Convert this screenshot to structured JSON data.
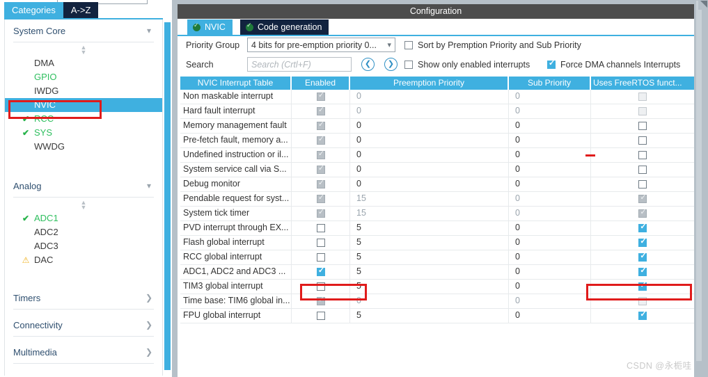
{
  "left_panel": {
    "tabs": [
      {
        "label": "Categories",
        "selected": true
      },
      {
        "label": "A->Z",
        "selected": false
      }
    ],
    "groups": [
      {
        "title": "System Core",
        "expanded": true,
        "chevron": "chevron-down-icon",
        "items": [
          {
            "label": "DMA",
            "status": "none",
            "selected": false
          },
          {
            "label": "GPIO",
            "status": "none",
            "selected": false,
            "green_text": true
          },
          {
            "label": "IWDG",
            "status": "none",
            "selected": false
          },
          {
            "label": "NVIC",
            "status": "none",
            "selected": true
          },
          {
            "label": "RCC",
            "status": "check",
            "selected": false,
            "green_text": true
          },
          {
            "label": "SYS",
            "status": "check",
            "selected": false,
            "green_text": true
          },
          {
            "label": "WWDG",
            "status": "none",
            "selected": false
          }
        ]
      },
      {
        "title": "Analog",
        "expanded": true,
        "chevron": "chevron-down-icon",
        "items": [
          {
            "label": "ADC1",
            "status": "check",
            "selected": false,
            "green_text": true
          },
          {
            "label": "ADC2",
            "status": "none",
            "selected": false
          },
          {
            "label": "ADC3",
            "status": "none",
            "selected": false
          },
          {
            "label": "DAC",
            "status": "warning",
            "selected": false
          }
        ]
      },
      {
        "title": "Timers",
        "expanded": false,
        "chevron": "chevron-right-icon",
        "items": []
      },
      {
        "title": "Connectivity",
        "expanded": false,
        "chevron": "chevron-right-icon",
        "items": []
      },
      {
        "title": "Multimedia",
        "expanded": false,
        "chevron": "chevron-right-icon",
        "items": []
      }
    ]
  },
  "config": {
    "title": "Configuration",
    "tabs": [
      {
        "label": "NVIC",
        "selected": true,
        "icon": "green-check-icon"
      },
      {
        "label": "Code generation",
        "selected": false,
        "icon": "green-check-icon"
      }
    ],
    "priority_group": {
      "label": "Priority Group",
      "value": "4 bits for pre-emption priority 0...",
      "chevron": "chevron-down-icon"
    },
    "search": {
      "label": "Search",
      "value": "",
      "placeholder": "Search (Crtl+F)",
      "prev_icon": "chevron-left-circle-icon",
      "next_icon": "chevron-right-circle-icon"
    },
    "options": [
      {
        "label": "Sort by Premption Priority and Sub Priority",
        "checked": false
      },
      {
        "label": "Show only enabled interrupts",
        "checked": false
      },
      {
        "label": "Force DMA channels Interrupts",
        "checked": true
      }
    ],
    "table": {
      "headers": [
        "NVIC Interrupt Table",
        "Enabled",
        "Preemption Priority",
        "Sub Priority",
        "Uses FreeRTOS funct..."
      ],
      "rows": [
        {
          "name": "Non maskable interrupt",
          "enabled": "disabled-checked",
          "preemption": "0",
          "sub": "0",
          "freertos": "disabled-unchecked",
          "dim": true
        },
        {
          "name": "Hard fault interrupt",
          "enabled": "disabled-checked",
          "preemption": "0",
          "sub": "0",
          "freertos": "disabled-unchecked",
          "dim": true
        },
        {
          "name": "Memory management fault",
          "enabled": "disabled-checked",
          "preemption": "0",
          "sub": "0",
          "freertos": "unchecked",
          "dim": false
        },
        {
          "name": "Pre-fetch fault, memory a...",
          "enabled": "disabled-checked",
          "preemption": "0",
          "sub": "0",
          "freertos": "unchecked",
          "dim": false
        },
        {
          "name": "Undefined instruction or il...",
          "enabled": "disabled-checked",
          "preemption": "0",
          "sub": "0",
          "freertos": "unchecked",
          "dim": false
        },
        {
          "name": "System service call via S...",
          "enabled": "disabled-checked",
          "preemption": "0",
          "sub": "0",
          "freertos": "unchecked",
          "dim": false
        },
        {
          "name": "Debug monitor",
          "enabled": "disabled-checked",
          "preemption": "0",
          "sub": "0",
          "freertos": "unchecked",
          "dim": false
        },
        {
          "name": "Pendable request for syst...",
          "enabled": "disabled-checked",
          "preemption": "15",
          "sub": "0",
          "freertos": "disabled-checked",
          "dim": true
        },
        {
          "name": "System tick timer",
          "enabled": "disabled-checked",
          "preemption": "15",
          "sub": "0",
          "freertos": "disabled-checked",
          "dim": true
        },
        {
          "name": "PVD interrupt through EX...",
          "enabled": "unchecked",
          "preemption": "5",
          "sub": "0",
          "freertos": "checked",
          "dim": false
        },
        {
          "name": "Flash global interrupt",
          "enabled": "unchecked",
          "preemption": "5",
          "sub": "0",
          "freertos": "checked",
          "dim": false
        },
        {
          "name": "RCC global interrupt",
          "enabled": "unchecked",
          "preemption": "5",
          "sub": "0",
          "freertos": "checked",
          "dim": false
        },
        {
          "name": "ADC1, ADC2 and ADC3 ...",
          "enabled": "checked",
          "preemption": "5",
          "sub": "0",
          "freertos": "checked",
          "dim": false
        },
        {
          "name": "TIM3 global interrupt",
          "enabled": "unchecked",
          "preemption": "5",
          "sub": "0",
          "freertos": "checked",
          "dim": false
        },
        {
          "name": "Time base: TIM6 global in...",
          "enabled": "disabled-checked",
          "preemption": "0",
          "sub": "0",
          "freertos": "disabled-unchecked",
          "dim": true
        },
        {
          "name": "FPU global interrupt",
          "enabled": "unchecked",
          "preemption": "5",
          "sub": "0",
          "freertos": "checked",
          "dim": false
        }
      ]
    }
  },
  "watermark": "CSDN @永栀哇",
  "colors": {
    "accent": "#3fb0e0",
    "dark_tab": "#12233f",
    "title_bar": "#4d4d4d",
    "highlight": "#e01b1b",
    "green": "#27b34a",
    "warn": "#f0b323",
    "panel_edge": "#b6c0c8"
  }
}
